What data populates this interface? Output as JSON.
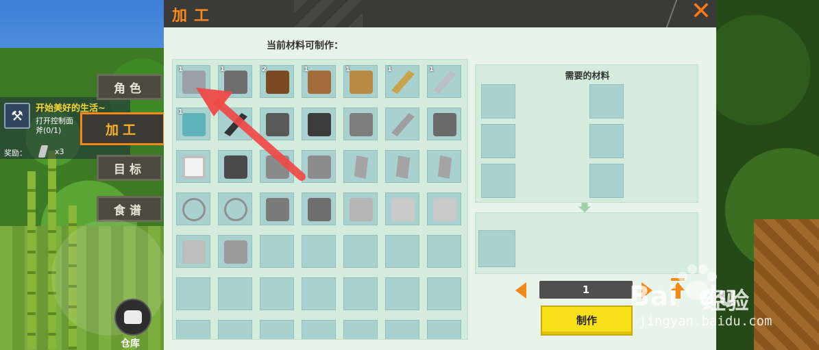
{
  "hud": {
    "task": {
      "title": "开始美好的生活~",
      "desc": "打开控制面",
      "progress": "斧(0/1)",
      "reward_label": "奖励：",
      "reward_count": "x3"
    },
    "tabs": [
      {
        "label": "角色",
        "active": false
      },
      {
        "label": "加工",
        "active": true
      },
      {
        "label": "目标",
        "active": false
      },
      {
        "label": "食谱",
        "active": false
      }
    ],
    "warehouse_label": "仓库"
  },
  "panel": {
    "title": "加工",
    "close_label": "✕",
    "subtitle": "当前材料可制作：",
    "materials_title": "需要的材料",
    "quantity": "1",
    "craft_label": "制作",
    "accent_color": "#f08a1a",
    "slots": [
      {
        "icon": "axe-icon",
        "count": "1"
      },
      {
        "icon": "pickaxe-icon",
        "count": "1"
      },
      {
        "icon": "wood-block-icon",
        "count": "2"
      },
      {
        "icon": "shovel-icon",
        "count": "1"
      },
      {
        "icon": "pitchfork-icon",
        "count": "1"
      },
      {
        "icon": "spear-icon",
        "count": "1"
      },
      {
        "icon": "sword-icon",
        "count": "1"
      },
      {
        "icon": "storage-box-icon",
        "count": "1"
      },
      {
        "icon": "torch-icon",
        "count": ""
      },
      {
        "icon": "campfire-icon",
        "count": ""
      },
      {
        "icon": "workbench-icon",
        "count": ""
      },
      {
        "icon": "shield-icon",
        "count": ""
      },
      {
        "icon": "drill-icon",
        "count": ""
      },
      {
        "icon": "hydrant-icon",
        "count": ""
      },
      {
        "icon": "frame-icon",
        "count": ""
      },
      {
        "icon": "camera-icon",
        "count": ""
      },
      {
        "icon": "lantern-icon",
        "count": ""
      },
      {
        "icon": "stone-block-icon",
        "count": ""
      },
      {
        "icon": "crystal-icon",
        "count": ""
      },
      {
        "icon": "crystal-icon",
        "count": ""
      },
      {
        "icon": "crystal-icon",
        "count": ""
      },
      {
        "icon": "rope-icon",
        "count": ""
      },
      {
        "icon": "rope-icon",
        "count": ""
      },
      {
        "icon": "stone-cube-icon",
        "count": ""
      },
      {
        "icon": "furnace-icon",
        "count": ""
      },
      {
        "icon": "plank-icon",
        "count": ""
      },
      {
        "icon": "grass-bundle-icon",
        "count": ""
      },
      {
        "icon": "grass-bundle-icon",
        "count": ""
      },
      {
        "icon": "paper-icon",
        "count": ""
      },
      {
        "icon": "statue-icon",
        "count": ""
      }
    ]
  },
  "watermark": {
    "brand": "Bai",
    "brand2": "du",
    "product": "经验",
    "url": "jingyan.baidu.com"
  }
}
